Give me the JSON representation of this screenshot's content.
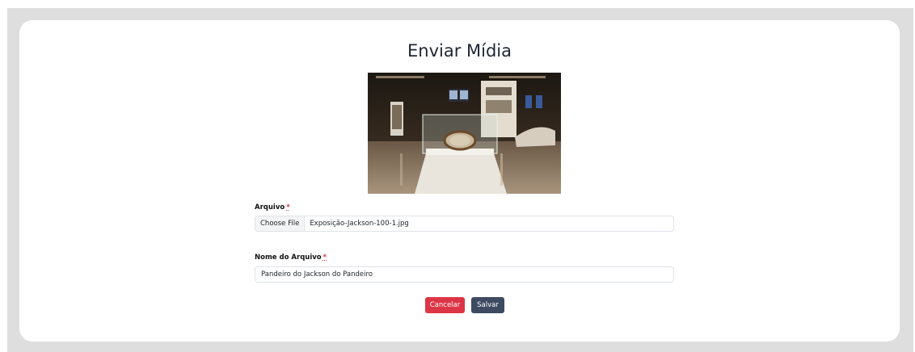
{
  "page": {
    "title": "Enviar Mídia"
  },
  "preview": {
    "image": "exhibition-photo",
    "alt": ""
  },
  "form": {
    "file": {
      "label": "Arquivo",
      "required_mark": "*",
      "choose_label": "Choose File",
      "value": "Exposição-Jackson-100-1.jpg"
    },
    "filename": {
      "label": "Nome do Arquivo",
      "required_mark": "*",
      "value": "Pandeiro do Jackson do Pandeiro"
    }
  },
  "actions": {
    "cancel_label": "Cancelar",
    "save_label": "Salvar"
  },
  "colors": {
    "cancel": "#dc3545",
    "save": "#3e4a62",
    "required": "#d9303f",
    "frame": "#dedede"
  }
}
